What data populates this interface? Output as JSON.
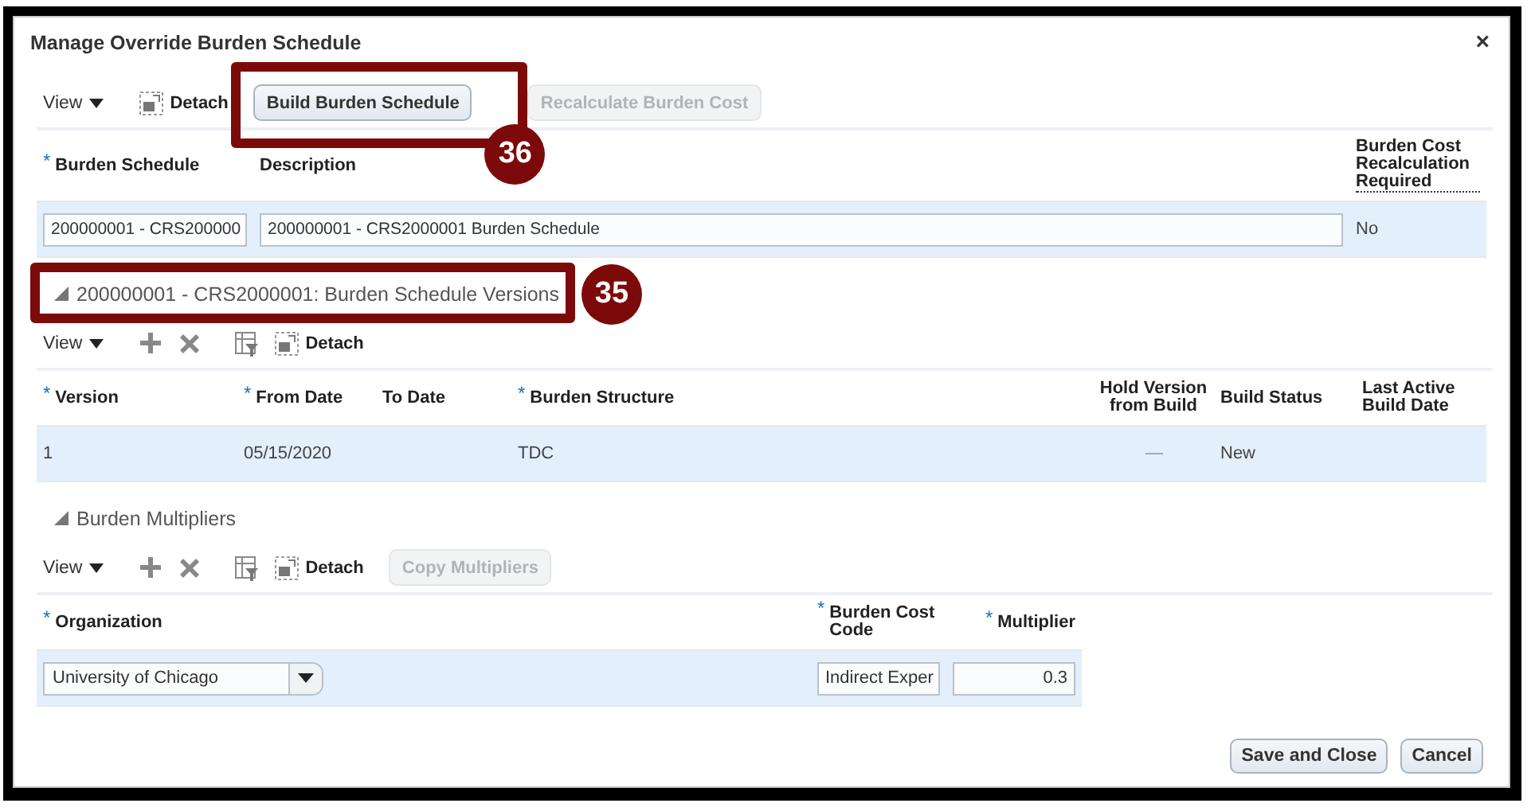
{
  "window": {
    "title": "Manage Override Burden Schedule",
    "close": "×"
  },
  "toolbar": {
    "items": [
      {
        "kind": "view",
        "label": "View"
      },
      {
        "kind": "detach",
        "label": "Detach"
      },
      {
        "kind": "button",
        "label": "Build Burden Schedule",
        "disabled": false,
        "callout": "36"
      },
      {
        "kind": "button",
        "label": "Recalculate Burden Cost",
        "disabled": true
      }
    ]
  },
  "schedule": {
    "columns": [
      {
        "label": "Burden Schedule",
        "marker": "*"
      },
      {
        "label": "Description"
      },
      {
        "label": "Burden Cost Recalculation Required",
        "help": true
      }
    ],
    "rows": [
      {
        "selected": true,
        "cells": [
          {
            "kind": "input",
            "value": "200000001 - CRS200000"
          },
          {
            "kind": "input",
            "value": "200000001 - CRS2000001 Burden Schedule"
          },
          {
            "kind": "text",
            "value": "No"
          }
        ]
      }
    ]
  },
  "versions": {
    "title": "200000001 - CRS2000001: Burden Schedule Versions",
    "expanded": true,
    "callout": "35",
    "toolbar": {
      "items": [
        {
          "kind": "view",
          "label": "View"
        },
        {
          "kind": "add"
        },
        {
          "kind": "delete"
        },
        {
          "kind": "freeze"
        },
        {
          "kind": "detach",
          "label": "Detach"
        }
      ]
    },
    "columns": [
      {
        "label": "Version",
        "marker": "*"
      },
      {
        "label": "From Date",
        "marker": "*"
      },
      {
        "label": "To Date"
      },
      {
        "label": "Burden Structure",
        "marker": "*"
      },
      {
        "label": "Hold Version from Build"
      },
      {
        "label": "Build Status"
      },
      {
        "label": "Last Active Build Date"
      }
    ],
    "rows": [
      {
        "selected": true,
        "cells": [
          {
            "kind": "text",
            "value": "1"
          },
          {
            "kind": "text",
            "value": "05/15/2020"
          },
          {
            "kind": "empty"
          },
          {
            "kind": "text",
            "value": "TDC"
          },
          {
            "kind": "dash"
          },
          {
            "kind": "text",
            "value": "New"
          },
          {
            "kind": "empty"
          }
        ]
      }
    ]
  },
  "multipliers": {
    "title": "Burden Multipliers",
    "expanded": true,
    "toolbar": {
      "items": [
        {
          "kind": "view",
          "label": "View"
        },
        {
          "kind": "add"
        },
        {
          "kind": "delete"
        },
        {
          "kind": "freeze"
        },
        {
          "kind": "detach",
          "label": "Detach"
        },
        {
          "kind": "button",
          "label": "Copy Multipliers",
          "disabled": true
        }
      ]
    },
    "columns": [
      {
        "label": "Organization",
        "marker": "*"
      },
      {
        "label": "Burden Cost Code",
        "marker": "*"
      },
      {
        "label": "Multiplier",
        "marker": "*"
      }
    ],
    "rows": [
      {
        "selected": true,
        "cells": [
          {
            "kind": "combo",
            "value": "University of Chicago"
          },
          {
            "kind": "choice",
            "value": "Indirect Exper"
          },
          {
            "kind": "number",
            "value": "0.3"
          }
        ]
      }
    ]
  },
  "footer": {
    "buttons": [
      {
        "label": "Save and Close"
      },
      {
        "label": "Cancel"
      }
    ]
  }
}
